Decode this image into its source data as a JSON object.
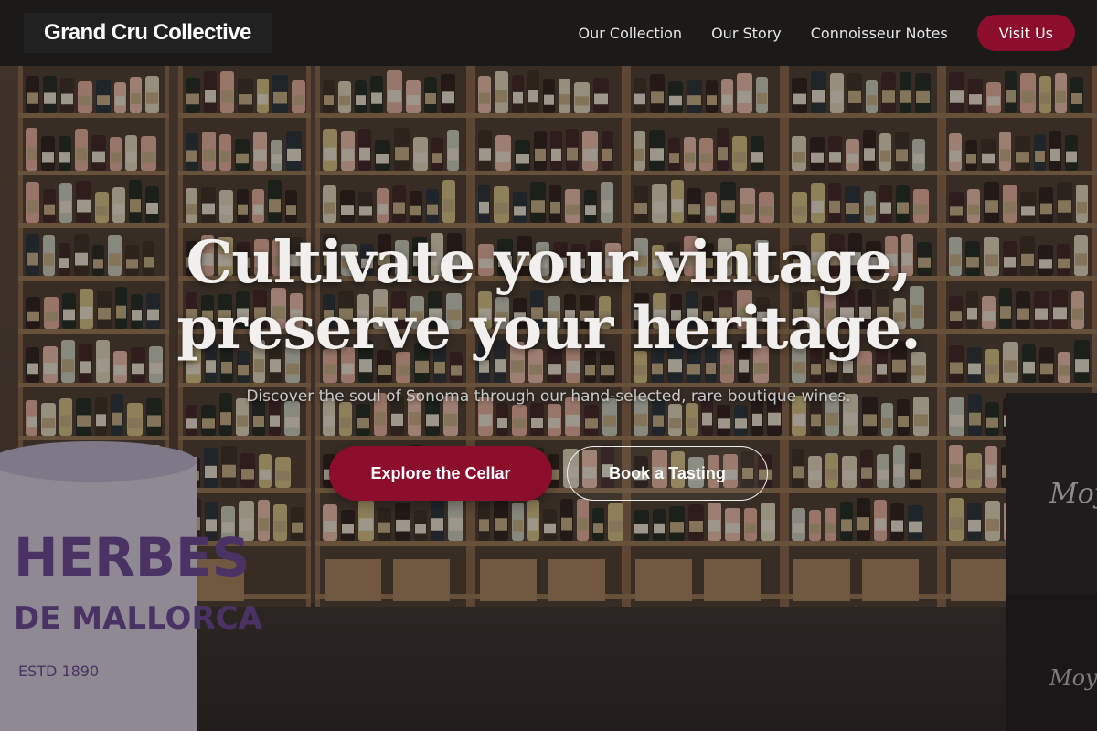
{
  "brand": {
    "name": "Grand Cru Collective"
  },
  "nav": {
    "links": [
      "Our Collection",
      "Our Story",
      "Connoisseur Notes"
    ],
    "cta": "Visit Us"
  },
  "hero": {
    "title_line_1": "Cultivate your vintage,",
    "title_line_2": "preserve your heritage.",
    "subtitle": "Discover the soul of Sonoma through our hand-selected, rare boutique wines.",
    "primary_button": "Explore the Cellar",
    "secondary_button": "Book a Tasting",
    "background": {
      "barrel_text_1": "HERBES",
      "barrel_text_2": "DE MALLORCA",
      "barrel_text_3": "ESTD 1890",
      "box_text": "Moyà"
    }
  },
  "colors": {
    "accent": "#8c0d2c",
    "header_bg": "#181818",
    "title_text": "#f2f0ee",
    "subtitle_text": "#c9c9c9"
  }
}
